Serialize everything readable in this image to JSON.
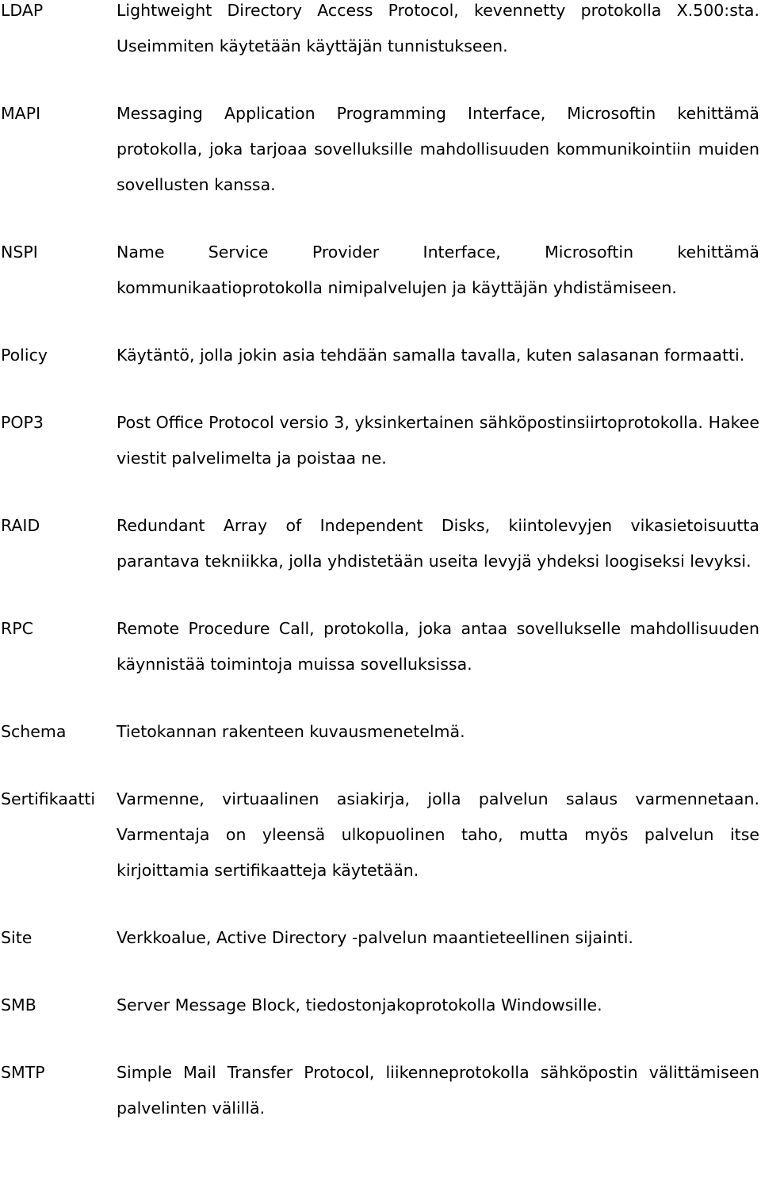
{
  "entries": [
    {
      "term": "LDAP",
      "definition": "Lightweight Directory Access Protocol, kevennetty protokolla X.500:sta. Useimmiten käytetään käyttäjän tunnistukseen."
    },
    {
      "term": "MAPI",
      "definition": "Messaging Application Programming Interface, Microsoftin kehittämä protokolla, joka tarjoaa sovelluksille mahdollisuuden kommunikointiin muiden sovellusten kanssa."
    },
    {
      "term": "NSPI",
      "definition": "Name Service Provider Interface, Microsoftin kehittämä kommunikaatioprotokolla nimipalvelujen ja käyttäjän yhdistämiseen."
    },
    {
      "term": "Policy",
      "definition": "Käytäntö, jolla jokin asia tehdään samalla tavalla, kuten salasanan formaatti."
    },
    {
      "term": "POP3",
      "definition": "Post Office Protocol versio 3, yksinkertainen sähköpostinsiirtoprotokolla. Hakee viestit palvelimelta ja poistaa ne."
    },
    {
      "term": "RAID",
      "definition": "Redundant Array of Independent Disks, kiintolevyjen vikasietoisuutta parantava tekniikka, jolla yhdistetään useita levyjä yhdeksi loogiseksi levyksi."
    },
    {
      "term": "RPC",
      "definition": "Remote Procedure Call, protokolla, joka antaa sovellukselle mahdollisuuden käynnistää toimintoja muissa sovelluksissa."
    },
    {
      "term": "Schema",
      "definition": "Tietokannan rakenteen kuvausmenetelmä."
    },
    {
      "term": "Sertifikaatti",
      "definition": "Varmenne, virtuaalinen asiakirja, jolla palvelun salaus varmennetaan. Varmentaja on yleensä ulkopuolinen taho, mutta myös palvelun itse kirjoittamia sertifikaatteja käytetään."
    },
    {
      "term": "Site",
      "definition": "Verkkoalue, Active Directory -palvelun maantieteellinen sijainti."
    },
    {
      "term": "SMB",
      "definition": "Server Message Block, tiedostonjakoprotokolla Windowsille."
    },
    {
      "term": "SMTP",
      "definition": "Simple Mail Transfer Protocol, liikenneprotokolla sähköpostin välittämiseen palvelinten välillä."
    }
  ]
}
